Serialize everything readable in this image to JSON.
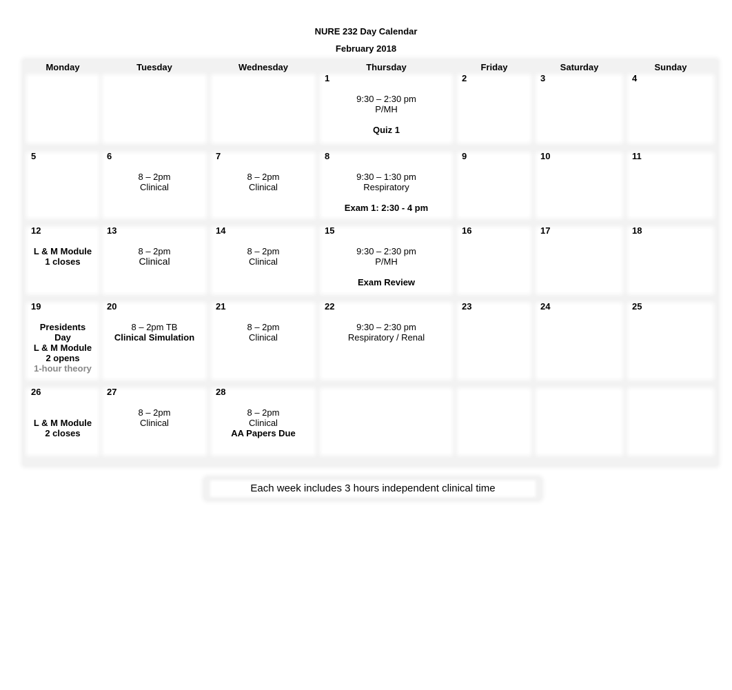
{
  "header": {
    "title": "NURE 232 Day Calendar",
    "month": "February 2018"
  },
  "days_of_week": [
    "Monday",
    "Tuesday",
    "Wednesday",
    "Thursday",
    "Friday",
    "Saturday",
    "Sunday"
  ],
  "weeks": [
    {
      "days": [
        {
          "num": "",
          "lines": []
        },
        {
          "num": "",
          "lines": []
        },
        {
          "num": "",
          "lines": []
        },
        {
          "num": "1",
          "lines": [
            "9:30 – 2:30 pm",
            "P/MH",
            "",
            "Quiz 1"
          ]
        },
        {
          "num": "2",
          "lines": []
        },
        {
          "num": "3",
          "lines": []
        },
        {
          "num": "4",
          "lines": []
        }
      ]
    },
    {
      "days": [
        {
          "num": "5",
          "lines": []
        },
        {
          "num": "6",
          "lines": [
            "8 – 2pm",
            "Clinical"
          ]
        },
        {
          "num": "7",
          "lines": [
            "8 – 2pm",
            "Clinical"
          ]
        },
        {
          "num": "8",
          "lines": [
            "9:30 – 1:30 pm",
            "Respiratory",
            "",
            "Exam 1: 2:30 - 4 pm"
          ]
        },
        {
          "num": "9",
          "lines": []
        },
        {
          "num": "10",
          "lines": []
        },
        {
          "num": "11",
          "lines": []
        }
      ]
    },
    {
      "days": [
        {
          "num": "12",
          "lines": [
            "L & M Module",
            "1 closes"
          ]
        },
        {
          "num": "13",
          "lines": [
            "8 – 2pm",
            "Clinical"
          ]
        },
        {
          "num": "14",
          "lines": [
            "8 – 2pm",
            "Clinical"
          ]
        },
        {
          "num": "15",
          "lines": [
            "9:30 – 2:30 pm",
            "P/MH",
            "",
            "Exam Review"
          ]
        },
        {
          "num": "16",
          "lines": []
        },
        {
          "num": "17",
          "lines": []
        },
        {
          "num": "18",
          "lines": []
        }
      ]
    },
    {
      "days": [
        {
          "num": "19",
          "lines": [
            "Presidents",
            "Day",
            "L & M Module",
            "2 opens",
            "1-hour theory"
          ]
        },
        {
          "num": "20",
          "lines": [
            "8 – 2pm TB",
            "Clinical Simulation"
          ]
        },
        {
          "num": "21",
          "lines": [
            "8 – 2pm",
            "Clinical"
          ]
        },
        {
          "num": "22",
          "lines": [
            "9:30 – 2:30 pm",
            "Respiratory / Renal"
          ]
        },
        {
          "num": "23",
          "lines": []
        },
        {
          "num": "24",
          "lines": []
        },
        {
          "num": "25",
          "lines": []
        }
      ]
    },
    {
      "days": [
        {
          "num": "26",
          "lines": [
            "",
            "L & M Module",
            "2 closes"
          ]
        },
        {
          "num": "27",
          "lines": [
            "8 – 2pm",
            "Clinical"
          ]
        },
        {
          "num": "28",
          "lines": [
            "8 – 2pm",
            "Clinical",
            "AA Papers Due"
          ]
        },
        {
          "num": "",
          "lines": []
        },
        {
          "num": "",
          "lines": []
        },
        {
          "num": "",
          "lines": []
        },
        {
          "num": "",
          "lines": []
        }
      ]
    }
  ],
  "footer": {
    "note": "Each week includes 3 hours independent clinical time"
  }
}
